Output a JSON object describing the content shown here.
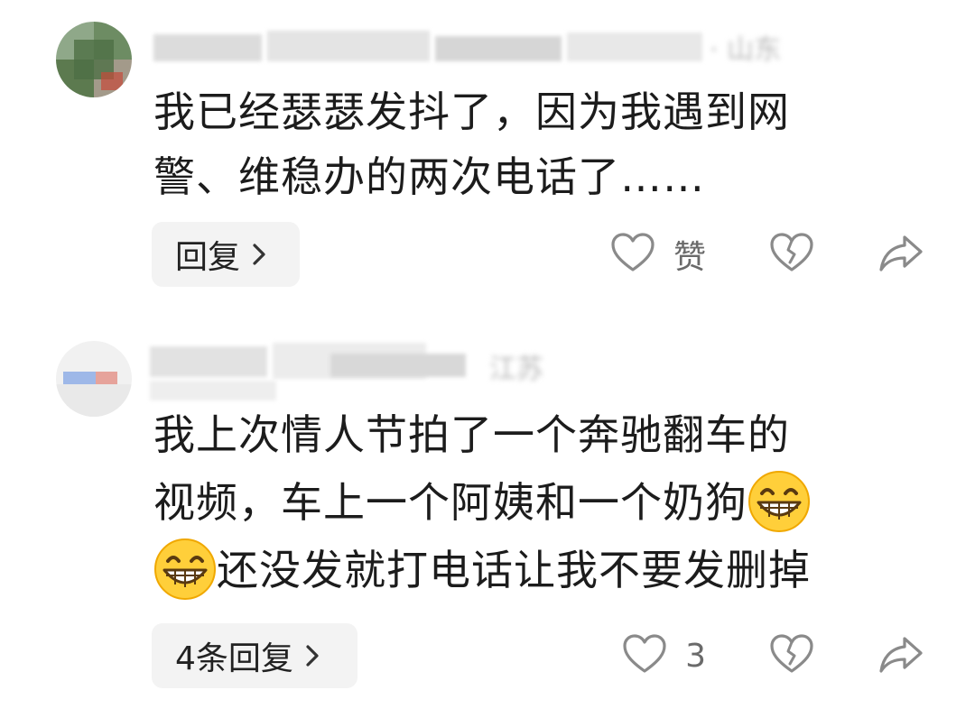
{
  "comments": [
    {
      "meta_visible": "· 山东",
      "body_lines": [
        "我已经瑟瑟发抖了，因为我遇到网",
        "警、维稳办的两次电话了……"
      ],
      "reply_label": "回复",
      "like_label": "赞"
    },
    {
      "meta_visible": "江苏",
      "body_lines": [
        "我上次情人节拍了一个奔驰翻车的",
        "视频，车上一个阿姨和一个奶狗",
        "还没发就打电话让我不要发删掉"
      ],
      "reply_label": "4条回复",
      "like_label": "3"
    }
  ],
  "icons": {
    "like": "heart-outline-icon",
    "dislike": "broken-heart-icon",
    "share": "share-arrow-icon",
    "chevron": "chevron-right-icon",
    "emoji": "grinning-face-emoji"
  },
  "colors": {
    "icon_gray": "#8a8a8a",
    "text": "#1c1c1c",
    "button_bg": "#f3f3f3"
  }
}
